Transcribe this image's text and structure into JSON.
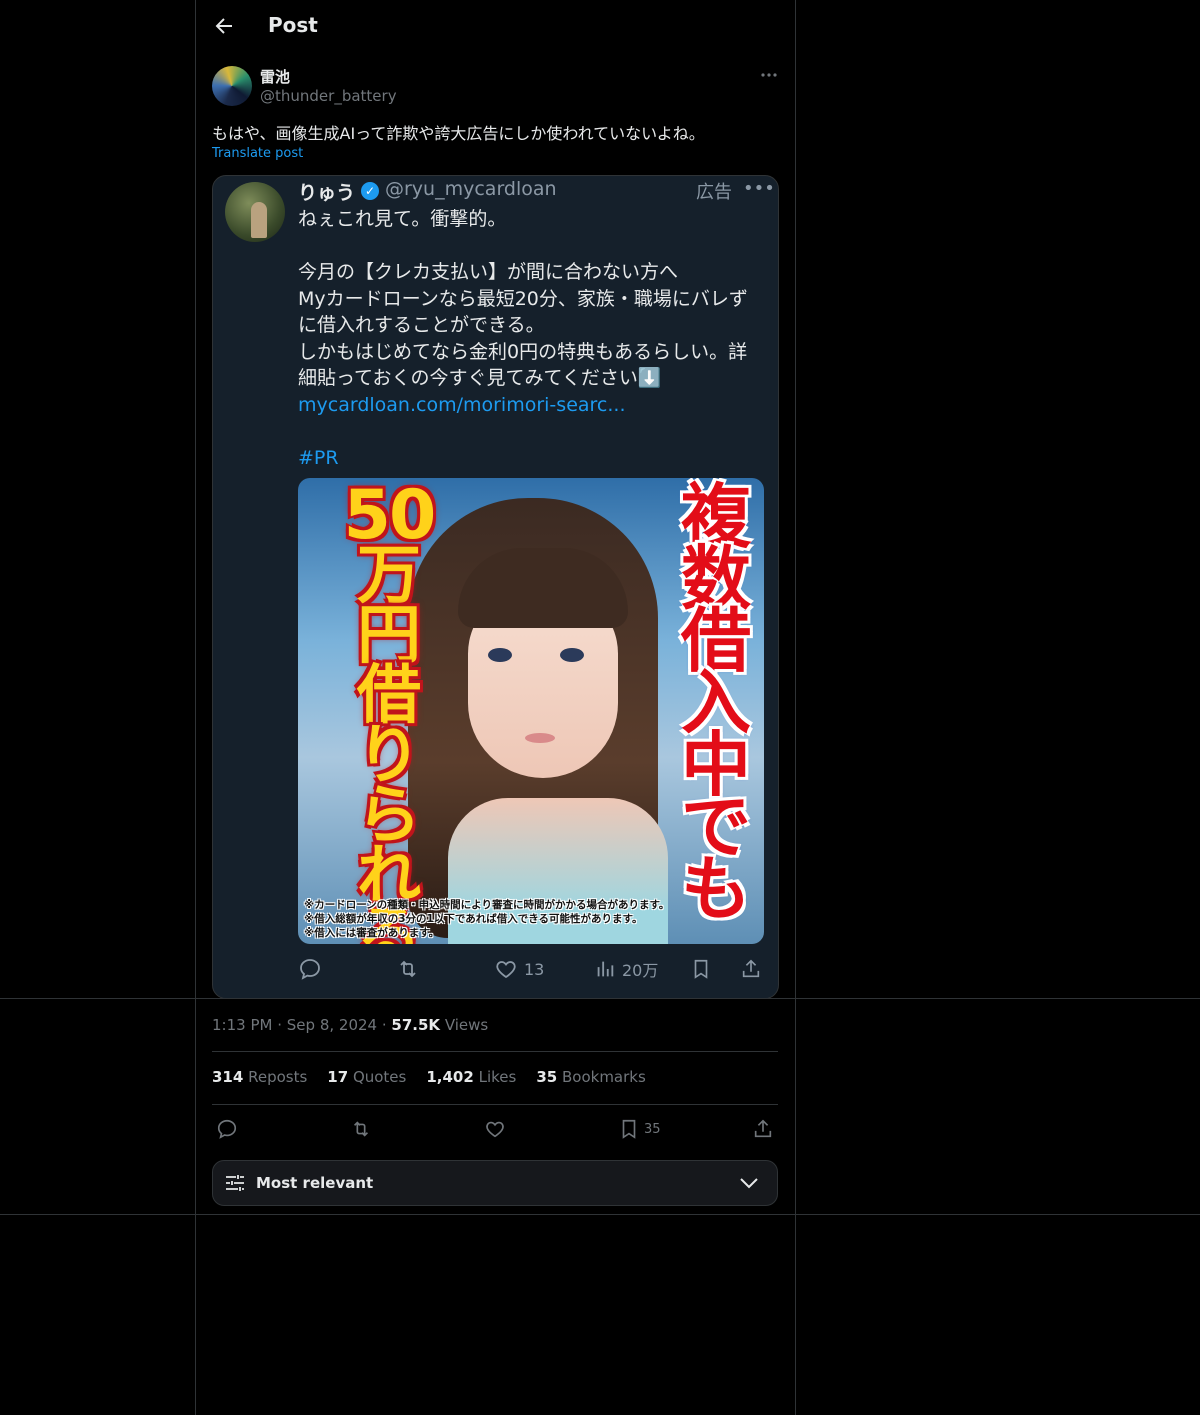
{
  "header": {
    "title": "Post"
  },
  "post": {
    "author_name": "雷池",
    "author_handle": "@thunder_battery",
    "text": "もはや、画像生成AIって詐欺や誇大広告にしか使われていないよね。",
    "translate_label": "Translate post",
    "more_icon": "more-icon"
  },
  "embedded": {
    "name": "りゅう",
    "handle": "@ryu_mycardloan",
    "ad_label": "広告",
    "line1": "ねぇこれ見て。衝撃的。",
    "line2": "今月の【クレカ支払い】が間に合わない方へ",
    "line3": "Myカードローンなら最短20分、家族・職場にバレず",
    "line4": "に借入れすることができる。",
    "line5": "しかもはじめてなら金利0円の特典もあるらしい。詳",
    "line6": "細貼っておくの今すぐ見てみてください⬇️",
    "link": "mycardloan.com/morimori-searc...",
    "hashtag": "#PR",
    "ad_image": {
      "left_number": "50",
      "left_text": "万円借りられる",
      "right_text": "複数借入中でも",
      "disclaimer1": "※カードローンの種類・申込時間により審査に時間がかかる場合があります。",
      "disclaimer2": "※借入総額が年収の3分の1以下であれば借入できる可能性があります。",
      "disclaimer3": "※借入には審査があります。"
    },
    "likes": "13",
    "views": "20万"
  },
  "details": {
    "time": "1:13 PM",
    "date": "Sep 8, 2024",
    "views_count": "57.5K",
    "views_label": "Views",
    "reposts_count": "314",
    "reposts_label": "Reposts",
    "quotes_count": "17",
    "quotes_label": "Quotes",
    "likes_count": "1,402",
    "likes_label": "Likes",
    "bookmarks_count": "35",
    "bookmarks_label": "Bookmarks",
    "bookmark_action_count": "35"
  },
  "filter": {
    "label": "Most relevant"
  }
}
